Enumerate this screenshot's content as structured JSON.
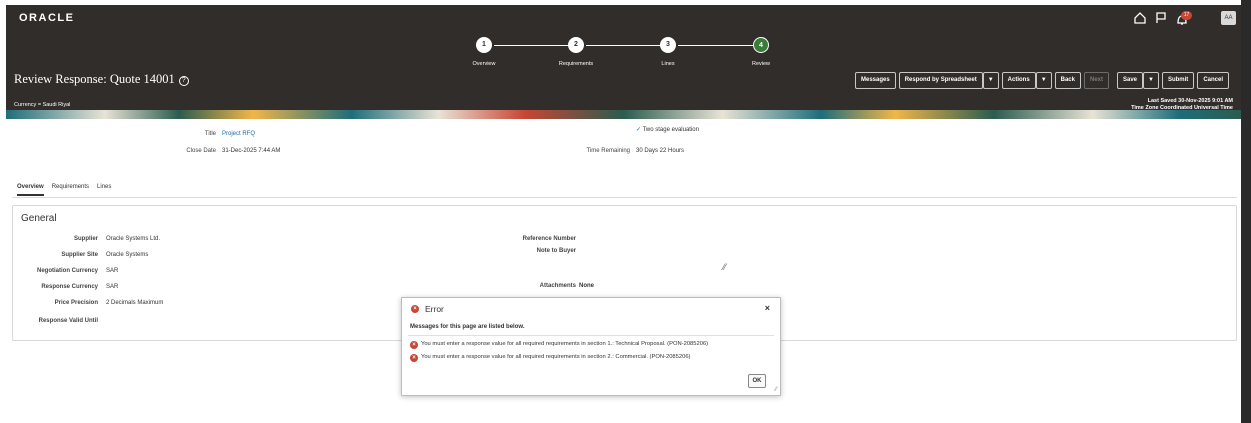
{
  "header": {
    "logo": "ORACLE",
    "notification_count": "17",
    "avatar_initials": "AA",
    "title": "Review Response: Quote 14001",
    "currency": "Currency = Saudi Riyal",
    "last_saved": "Last Saved 30-Nov-2025 9:01 AM",
    "time_zone": "Time Zone Coordinated Universal Time"
  },
  "train": [
    {
      "num": "1",
      "label": "Overview"
    },
    {
      "num": "2",
      "label": "Requirements"
    },
    {
      "num": "3",
      "label": "Lines"
    },
    {
      "num": "4",
      "label": "Review"
    }
  ],
  "buttons": {
    "messages": "Messages",
    "respond": "Respond by Spreadsheet",
    "actions": "Actions",
    "back": "Back",
    "next": "Next",
    "save": "Save",
    "submit": "Submit",
    "cancel": "Cancel",
    "dd": "▼"
  },
  "summary": {
    "title_label": "Title",
    "title_value": "Project RFQ",
    "close_label": "Close Date",
    "close_value": "31-Dec-2025 7:44 AM",
    "two_stage": "Two stage evaluation",
    "time_remaining_label": "Time Remaining",
    "time_remaining_value": "30 Days 22 Hours"
  },
  "tabs": [
    "Overview",
    "Requirements",
    "Lines"
  ],
  "general": {
    "heading": "General",
    "fields": [
      {
        "label": "Supplier",
        "value": "Oracle Systems Ltd."
      },
      {
        "label": "Supplier Site",
        "value": "Oracle Systems"
      },
      {
        "label": "Negotiation Currency",
        "value": "SAR"
      },
      {
        "label": "Response Currency",
        "value": "SAR"
      },
      {
        "label": "Price Precision",
        "value": "2 Decimals Maximum"
      },
      {
        "label": "Response Valid Until",
        "value": ""
      }
    ],
    "right_fields": [
      {
        "label": "Reference Number",
        "value": ""
      },
      {
        "label": "Note to Buyer",
        "value": ""
      },
      {
        "label": "Attachments",
        "value": "None"
      }
    ]
  },
  "dialog": {
    "title": "Error",
    "subtitle": "Messages for this page are listed below.",
    "messages": [
      "You must enter a response value for all required requirements in section 1.: Technical Proposal. (PON-2085206)",
      "You must enter a response value for all required requirements in section 2.: Commercial. (PON-2085206)"
    ],
    "ok": "OK",
    "close": "×"
  },
  "colors": {
    "header_bg": "#312d2a",
    "step_current": "#3a7d3a",
    "error_red": "#c74634",
    "link_blue": "#1f6aa5"
  }
}
